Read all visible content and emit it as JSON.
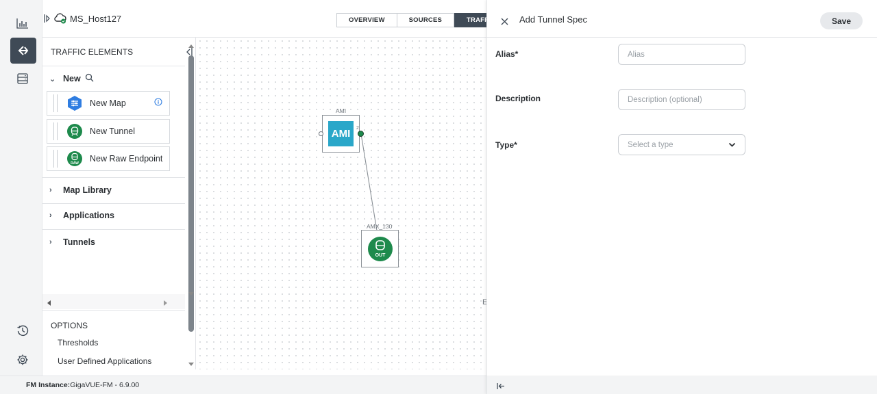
{
  "header": {
    "instance_name": "MS_Host127",
    "tabs": [
      "OVERVIEW",
      "SOURCES",
      "TRAFFIC"
    ]
  },
  "rail": {
    "icons": [
      "dashboard-chart-icon",
      "traffic-flow-icon",
      "inventory-icon",
      "history-icon",
      "settings-icon"
    ]
  },
  "elements_panel": {
    "title": "TRAFFIC ELEMENTS",
    "new_section": {
      "label": "New"
    },
    "cards": [
      {
        "label": "New Map",
        "icon": "map-icon"
      },
      {
        "label": "New Tunnel",
        "icon": "tunnel-icon"
      },
      {
        "label": "New Raw Endpoint",
        "icon": "raw-endpoint-icon",
        "badge": "RAW"
      }
    ],
    "groups": [
      "Map Library",
      "Applications",
      "Tunnels"
    ],
    "options_title": "OPTIONS",
    "options": [
      "Thresholds",
      "User Defined Applications"
    ]
  },
  "canvas": {
    "node_ami": {
      "label": "AMI",
      "text": "AMI",
      "port": "2"
    },
    "node_amx": {
      "label": "AMX_130",
      "badge": "OUT"
    },
    "edge_letter": "E"
  },
  "drawer": {
    "title": "Add Tunnel Spec",
    "save_label": "Save",
    "fields": {
      "alias": {
        "label": "Alias*",
        "placeholder": "Alias"
      },
      "description": {
        "label": "Description",
        "placeholder": "Description (optional)"
      },
      "type": {
        "label": "Type*",
        "placeholder": "Select a type"
      }
    }
  },
  "status_bar": {
    "prefix": "FM Instance:",
    "value": "GigaVUE-FM - 6.9.00"
  },
  "colors": {
    "accent_dark": "#3f4a56",
    "green": "#1e8a4c",
    "blue": "#2f7de1",
    "teal": "#2aa7c9"
  }
}
